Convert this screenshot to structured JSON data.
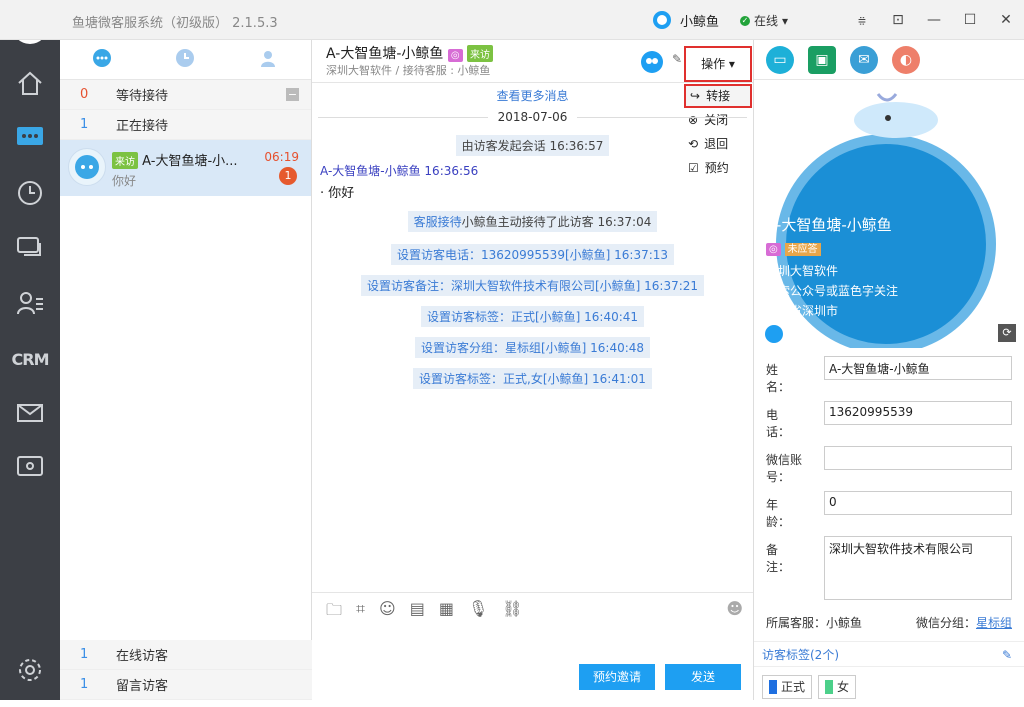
{
  "app": {
    "title": "鱼塘微客服系统（初级版） 2.1.5.3",
    "user": "小鲸鱼",
    "status": "在线"
  },
  "queue": {
    "waiting": {
      "count": "0",
      "label": "等待接待"
    },
    "serving": {
      "count": "1",
      "label": "正在接待"
    },
    "online": {
      "count": "1",
      "label": "在线访客"
    },
    "message": {
      "count": "1",
      "label": "留言访客"
    }
  },
  "conversation": {
    "badge": "来访",
    "name": "A-大智鱼塘-小...",
    "preview": "你好",
    "time": "06:19",
    "unread": "1"
  },
  "chat": {
    "title": "A-大智鱼塘-小鲸鱼",
    "badge": "来访",
    "subtitle": "深圳大智软件 / 接待客服 : 小鲸鱼",
    "operate_label": "操作",
    "menu": [
      "转接",
      "关闭",
      "退回",
      "预约"
    ],
    "more": "查看更多消息",
    "date": "2018-07-06",
    "start_msg": "由访客发起会话 16:36:57",
    "visitor_name": "A-大智鱼塘-小鲸鱼 16:36:56",
    "visitor_text": "· 你好",
    "accept_prefix": "客服接待",
    "accept_msg": "小鲸鱼主动接待了此访客 16:37:04",
    "events": [
      "设置访客电话：13620995539[小鲸鱼] 16:37:13",
      "设置访客备注：深圳大智软件技术有限公司[小鲸鱼] 16:37:21",
      "设置访客标签：正式[小鲸鱼] 16:40:41",
      "设置访客分组：星标组[小鲸鱼] 16:40:48",
      "设置访客标签：正式,女[小鲸鱼] 16:41:01"
    ],
    "invite_label": "预约邀请",
    "send_label": "发送"
  },
  "profile": {
    "name": "A-大智鱼塘-小鲸鱼",
    "tag": "未应答",
    "company": "深圳大智软件",
    "slogan": "搜索公众号或蓝色字关注",
    "location": "广东省深圳市"
  },
  "form": [
    {
      "label": "姓　　名：",
      "value": "A-大智鱼塘-小鲸鱼"
    },
    {
      "label": "电　　话：",
      "value": "13620995539"
    },
    {
      "label": "微信账号：",
      "value": ""
    },
    {
      "label": "年　　龄：",
      "value": "0"
    },
    {
      "label": "备　　注：",
      "value": "深圳大智软件技术有限公司"
    }
  ],
  "meta": {
    "agent": "所属客服：小鲸鱼",
    "group_label": "微信分组：",
    "group_value": "星标组"
  },
  "tags": {
    "header": "访客标签(2个)",
    "items": [
      "正式",
      "女"
    ],
    "colors": [
      "#1e6fe0",
      "#4cd08a"
    ]
  },
  "colors": {
    "accent": "#1e9ff2",
    "sidebar": "#3c3f45"
  }
}
